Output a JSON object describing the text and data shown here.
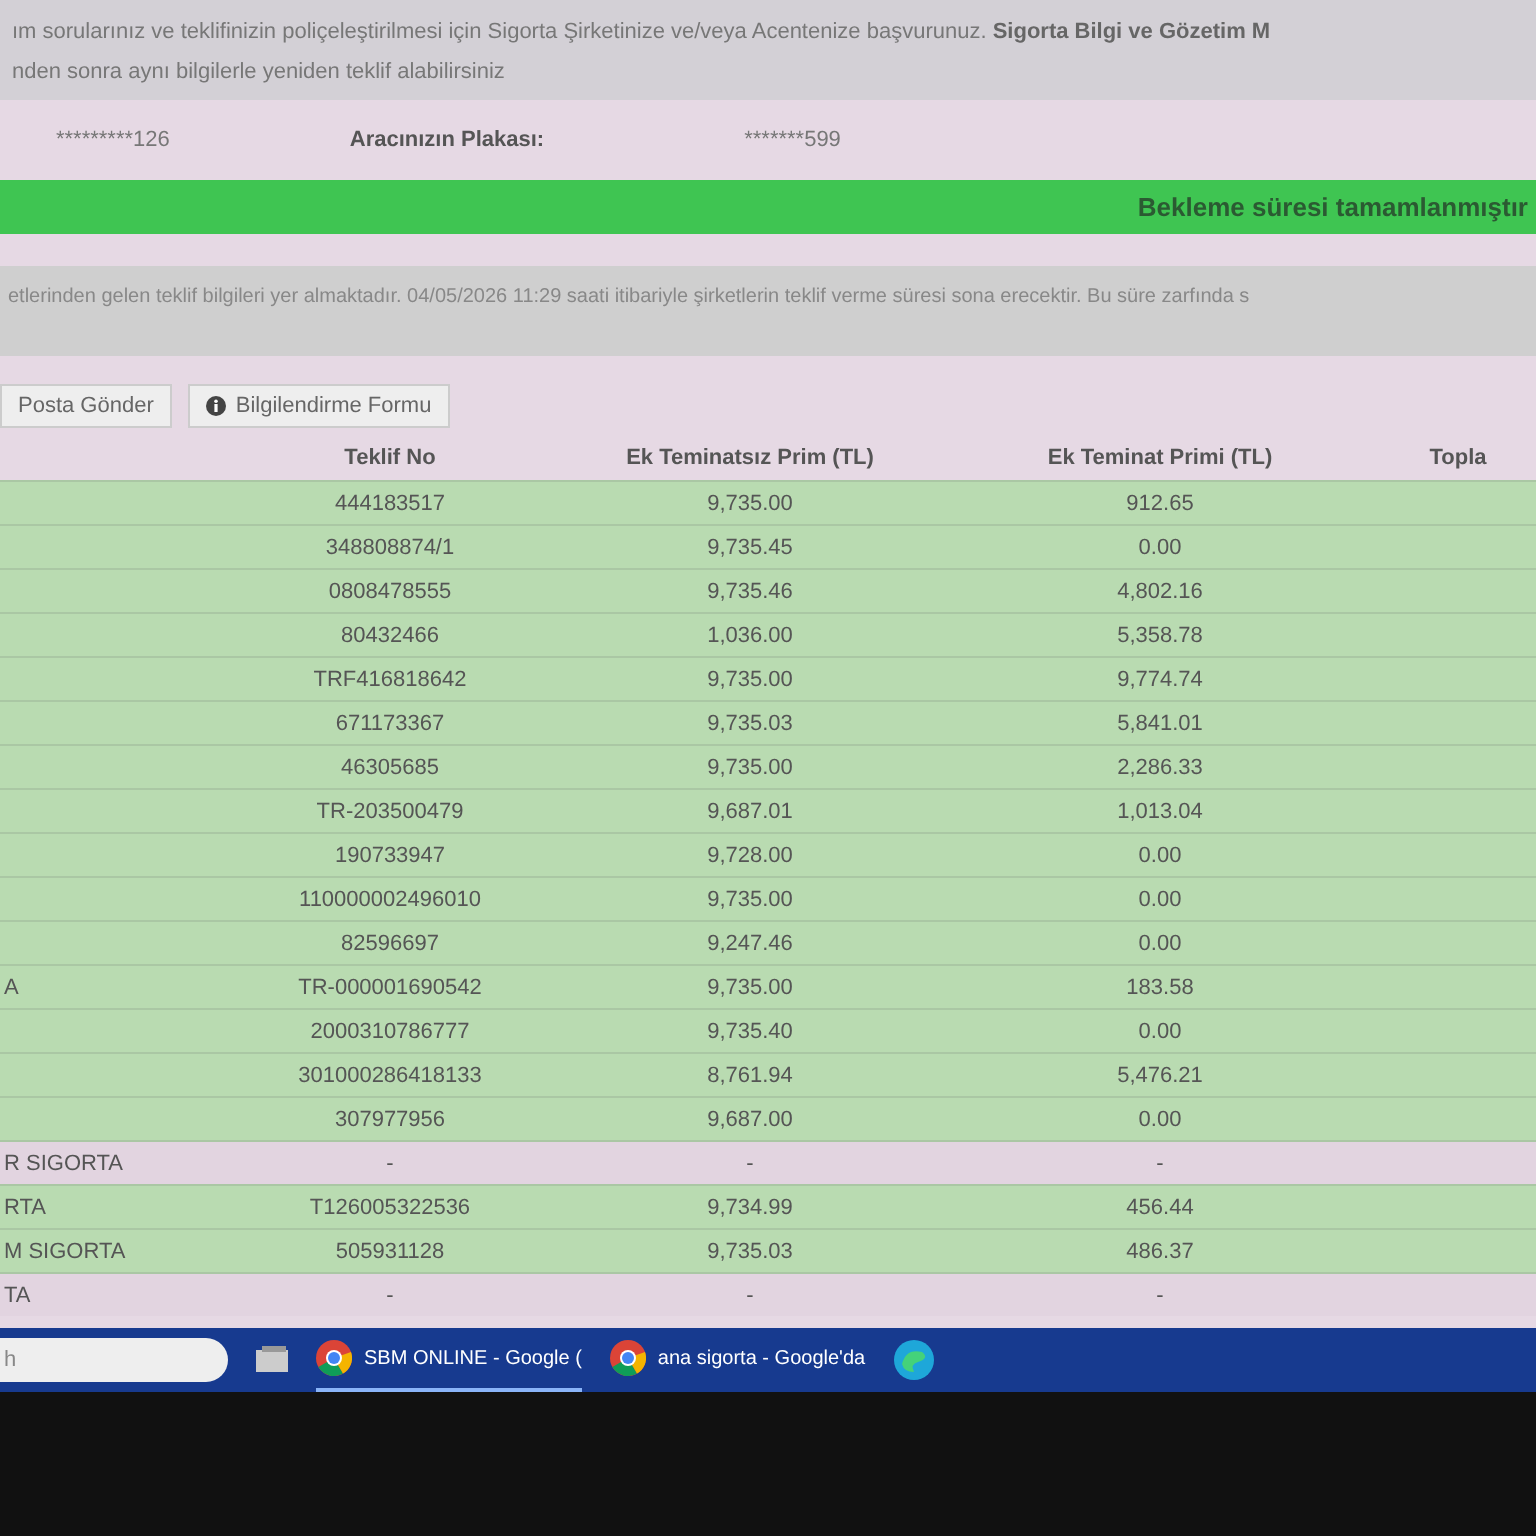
{
  "notice": {
    "lines": [
      "ım sorularınız ve teklifinizin poliçeleştirilmesi için Sigorta Şirketinize ve/veya Acentenize başvurunuz. **Sigorta Bilgi ve Gözetim M**",
      "nden sonra aynı bilgilerle yeniden teklif alabilirsiniz"
    ]
  },
  "vehicle": {
    "masked_id": "*********126",
    "plate_label": "Aracınızın Plakası:",
    "plate_value": "*******599"
  },
  "status_banner": "Bekleme süresi tamamlanmıştır",
  "info": "etlerinden gelen teklif bilgileri yer almaktadır. 04/05/2026 11:29 saati itibariyle şirketlerin teklif verme süresi sona erecektir. Bu süre zarfında s",
  "buttons": [
    {
      "label": "Posta Gönder",
      "kind": "plain"
    },
    {
      "label": "Bilgilendirme Formu",
      "kind": "info"
    }
  ],
  "table": {
    "columns": [
      "Teklif No",
      "Ek Teminatsız Prim (TL)",
      "Ek Teminat Primi (TL)",
      "Topla"
    ],
    "rows": [
      {
        "kind": "offer",
        "company": "",
        "teklif_no": "444183517",
        "prim": "9,735.00",
        "ek_prim": "912.65"
      },
      {
        "kind": "offer",
        "company": "",
        "teklif_no": "348808874/1",
        "prim": "9,735.45",
        "ek_prim": "0.00"
      },
      {
        "kind": "offer",
        "company": "",
        "teklif_no": "0808478555",
        "prim": "9,735.46",
        "ek_prim": "4,802.16"
      },
      {
        "kind": "offer",
        "company": "",
        "teklif_no": "80432466",
        "prim": "1,036.00",
        "ek_prim": "5,358.78"
      },
      {
        "kind": "offer",
        "company": "",
        "teklif_no": "TRF416818642",
        "prim": "9,735.00",
        "ek_prim": "9,774.74"
      },
      {
        "kind": "offer",
        "company": "",
        "teklif_no": "671173367",
        "prim": "9,735.03",
        "ek_prim": "5,841.01"
      },
      {
        "kind": "offer",
        "company": "",
        "teklif_no": "46305685",
        "prim": "9,735.00",
        "ek_prim": "2,286.33"
      },
      {
        "kind": "offer",
        "company": "",
        "teklif_no": "TR-203500479",
        "prim": "9,687.01",
        "ek_prim": "1,013.04"
      },
      {
        "kind": "offer",
        "company": "",
        "teklif_no": "190733947",
        "prim": "9,728.00",
        "ek_prim": "0.00"
      },
      {
        "kind": "offer",
        "company": "",
        "teklif_no": "110000002496010",
        "prim": "9,735.00",
        "ek_prim": "0.00"
      },
      {
        "kind": "offer",
        "company": "",
        "teklif_no": "82596697",
        "prim": "9,247.46",
        "ek_prim": "0.00"
      },
      {
        "kind": "offer",
        "company": "A",
        "teklif_no": "TR-000001690542",
        "prim": "9,735.00",
        "ek_prim": "183.58"
      },
      {
        "kind": "offer",
        "company": "",
        "teklif_no": "2000310786777",
        "prim": "9,735.40",
        "ek_prim": "0.00"
      },
      {
        "kind": "offer",
        "company": "",
        "teklif_no": "301000286418133",
        "prim": "8,761.94",
        "ek_prim": "5,476.21"
      },
      {
        "kind": "offer",
        "company": "",
        "teklif_no": "307977956",
        "prim": "9,687.00",
        "ek_prim": "0.00"
      },
      {
        "kind": "none",
        "company": "R SIGORTA",
        "teklif_no": "-",
        "prim": "-",
        "ek_prim": "-"
      },
      {
        "kind": "offer",
        "company": "RTA",
        "teklif_no": "T126005322536",
        "prim": "9,734.99",
        "ek_prim": "456.44"
      },
      {
        "kind": "offer",
        "company": "M SIGORTA",
        "teklif_no": "505931128",
        "prim": "9,735.03",
        "ek_prim": "486.37"
      },
      {
        "kind": "none",
        "company": "TA",
        "teklif_no": "-",
        "prim": "-",
        "ek_prim": "-"
      }
    ]
  },
  "taskbar": {
    "search": "h",
    "items": [
      {
        "label": "SBM ONLINE - Google (",
        "selected": true
      },
      {
        "label": "ana sigorta - Google'da",
        "selected": false
      }
    ]
  }
}
